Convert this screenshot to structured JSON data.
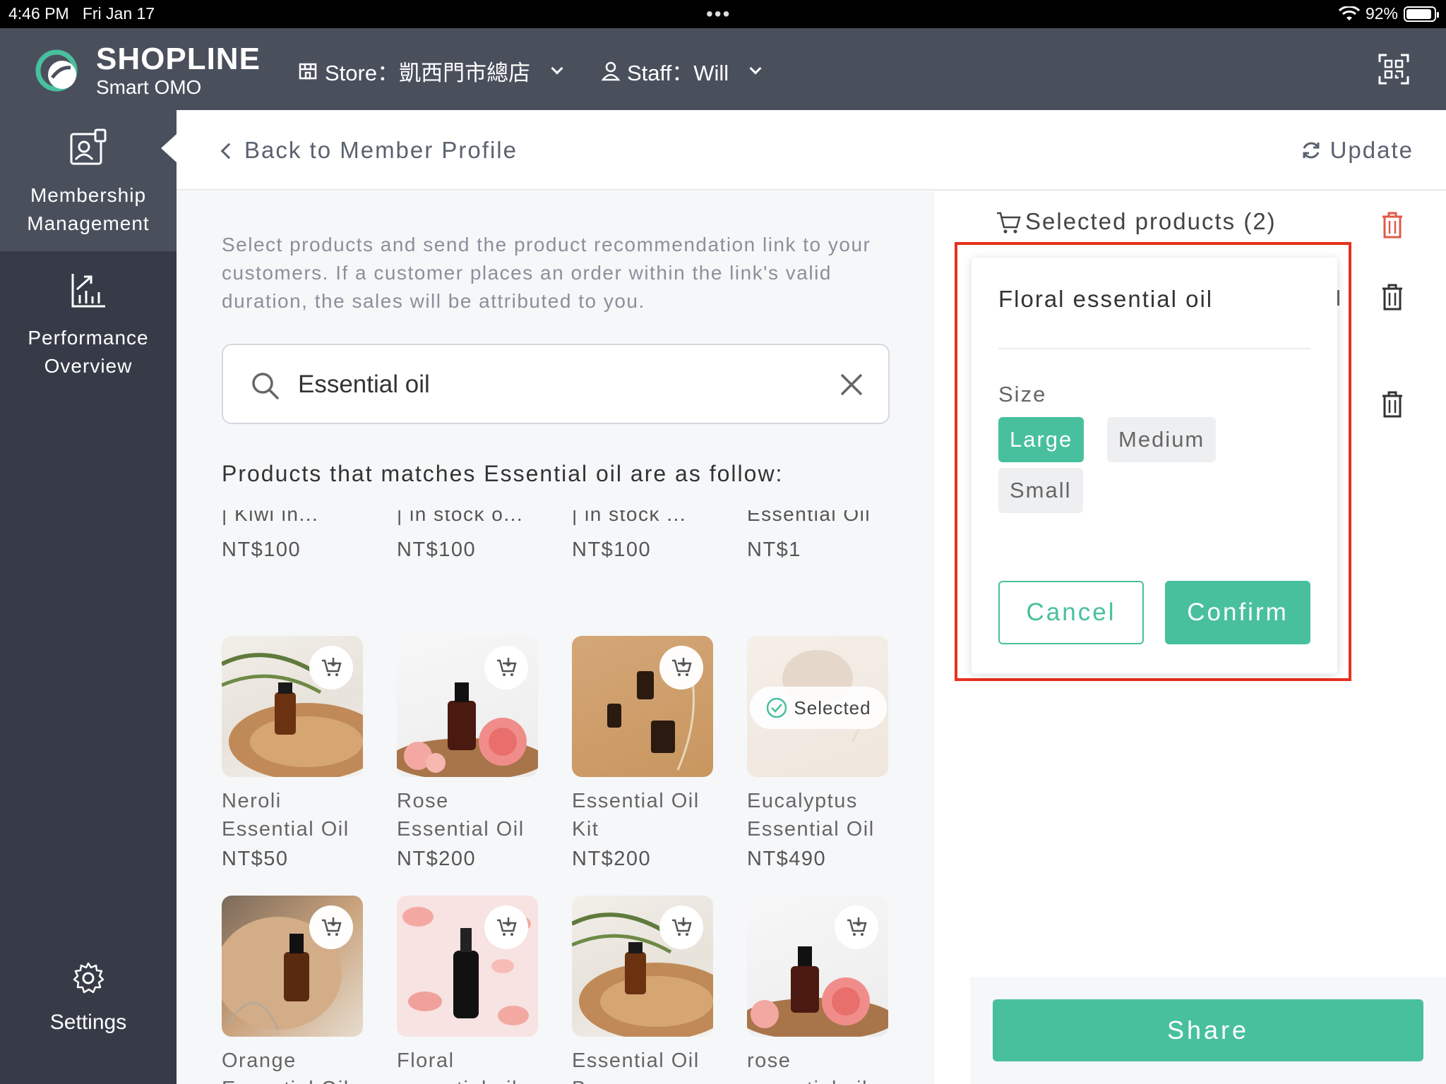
{
  "status_bar": {
    "time": "4:46 PM",
    "date": "Fri Jan 17",
    "battery": "92%"
  },
  "brand": {
    "name": "SHOPLINE",
    "product": "Smart OMO",
    "accent": "#48c09e"
  },
  "header": {
    "store_label": "Store：凱西門市總店",
    "staff_label": "Staff：Will"
  },
  "sidebar": {
    "items": [
      {
        "label_line1": "Membership",
        "label_line2": "Management",
        "icon": "member-card-icon",
        "active": true
      },
      {
        "label_line1": "Performance",
        "label_line2": "Overview",
        "icon": "chart-icon",
        "active": false
      }
    ],
    "settings_label": "Settings"
  },
  "topnav": {
    "back_label": "Back to Member Profile",
    "update_label": "Update"
  },
  "main": {
    "description": "Select products and send the product recommendation link to your customers. If a customer places an order within the link's valid duration, the sales will be attributed to you.",
    "search": {
      "value": "Essential oil"
    },
    "matches_label": "Products that matches Essential oil are as follow:",
    "previous_row": [
      {
        "title": "| Kiwi in...",
        "price": "NT$100"
      },
      {
        "title": "| in stock o...",
        "price": "NT$100"
      },
      {
        "title": "| in stock ...",
        "price": "NT$100"
      },
      {
        "title": "Essential Oil",
        "price": "NT$1"
      }
    ],
    "row1": [
      {
        "name1": "Neroli",
        "name2": "Essential Oil",
        "price": "NT$50"
      },
      {
        "name1": "Rose",
        "name2": "Essential Oil",
        "price": "NT$200"
      },
      {
        "name1": "Essential Oil",
        "name2": "Kit",
        "price": "NT$200"
      },
      {
        "name1": "Eucalyptus",
        "name2": "Essential Oil",
        "price": "NT$490",
        "selected_label": "Selected"
      }
    ],
    "row2": [
      {
        "name1": "Orange",
        "name2": "Essential Oil"
      },
      {
        "name1": "Floral",
        "name2": "essential oil"
      },
      {
        "name1": "Essential Oil",
        "name2": "Base"
      },
      {
        "name1": "rose",
        "name2": "essential oil"
      }
    ]
  },
  "selected": {
    "header": "Selected products (2)"
  },
  "popup": {
    "product": "Floral essential oil",
    "size_label": "Size",
    "options": [
      "Large",
      "Medium",
      "Small"
    ],
    "selected_option": "Large",
    "cancel_label": "Cancel",
    "confirm_label": "Confirm"
  },
  "share_label": "Share"
}
